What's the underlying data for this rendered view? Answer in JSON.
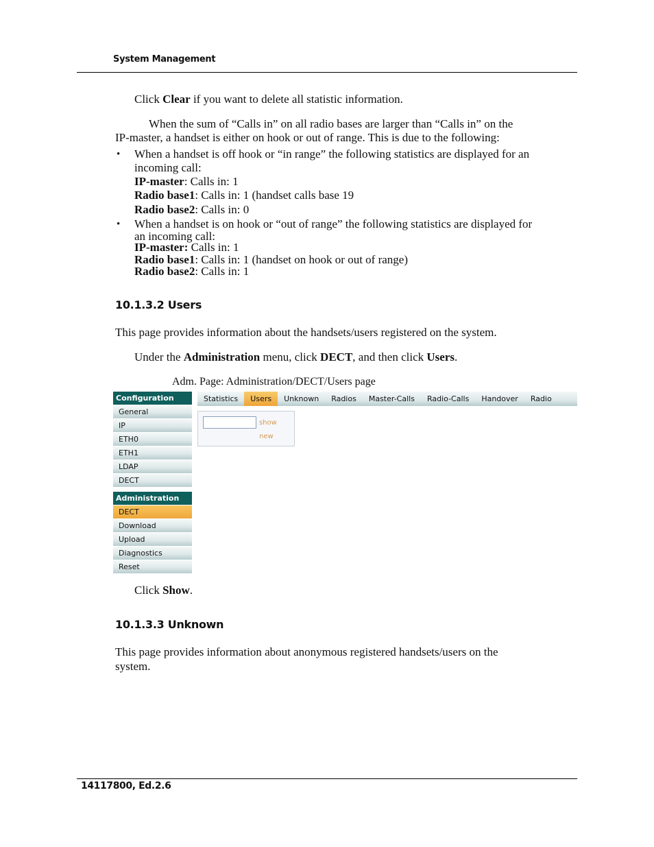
{
  "header": {
    "title": "System Management"
  },
  "footer": {
    "doc_id": "14117800, Ed.2.6"
  },
  "intro": {
    "click_pre": "Click ",
    "clear_label": "Clear",
    "click_post": " if you want to delete all statistic information."
  },
  "note": {
    "line1": "When the sum of “Calls in” on all radio bases are larger than “Calls in” on the",
    "line2": "IP-master, a handset is either on hook or out of range. This is due to the following:"
  },
  "bullets": [
    {
      "symbol": "•",
      "line1": "When a handset is off hook or “in range” the following statistics are displayed for an",
      "line2": "incoming call:",
      "stats": [
        {
          "label": "IP-master",
          "value": ": Calls in: 1"
        },
        {
          "label": "Radio base1",
          "value": ": Calls in: 1 (handset calls base 19"
        },
        {
          "label": "Radio base2",
          "value": ": Calls in: 0"
        }
      ]
    },
    {
      "symbol": "•",
      "line1": "When a handset is on hook or “out of range” the following statistics are displayed for",
      "line2": "an incoming call:",
      "stats": [
        {
          "label": "IP-master:",
          "value": " Calls in: 1"
        },
        {
          "label": "Radio base1",
          "value": ": Calls in: 1 (handset on hook or out of range)"
        },
        {
          "label": "Radio base2",
          "value": ": Calls in: 1"
        }
      ]
    }
  ],
  "section_users": {
    "heading": "10.1.3.2  Users",
    "description": "This page provides information about the handsets/users registered on the system.",
    "instr_pre": "Under the ",
    "instr_menu": "Administration",
    "instr_mid1": " menu, click ",
    "instr_dect": "DECT",
    "instr_mid2": ", and then click ",
    "instr_users": "Users",
    "instr_end": ".",
    "caption": "Adm. Page: Administration/DECT/Users page",
    "click_pre": "Click ",
    "click_show": "Show",
    "click_end": "."
  },
  "screenshot": {
    "sidebar": {
      "configuration": {
        "heading": "Configuration",
        "items": [
          "General",
          "IP",
          "ETH0",
          "ETH1",
          "LDAP",
          "DECT"
        ]
      },
      "administration": {
        "heading": "Administration",
        "items": [
          "DECT",
          "Download",
          "Upload",
          "Diagnostics",
          "Reset"
        ],
        "active_index": 0
      }
    },
    "tabs": [
      "Statistics",
      "Users",
      "Unknown",
      "Radios",
      "Master-Calls",
      "Radio-Calls",
      "Handover",
      "Radio"
    ],
    "active_tab": "Users",
    "search_value": "",
    "show_link": "show",
    "new_link": "new",
    "colors": {
      "nav_head": "#0f5f5c",
      "active": "#f0a73a",
      "link": "#d59a55"
    }
  },
  "section_unknown": {
    "heading": "10.1.3.3  Unknown",
    "line1": "This page provides information about anonymous registered handsets/users on the",
    "line2": "system."
  }
}
